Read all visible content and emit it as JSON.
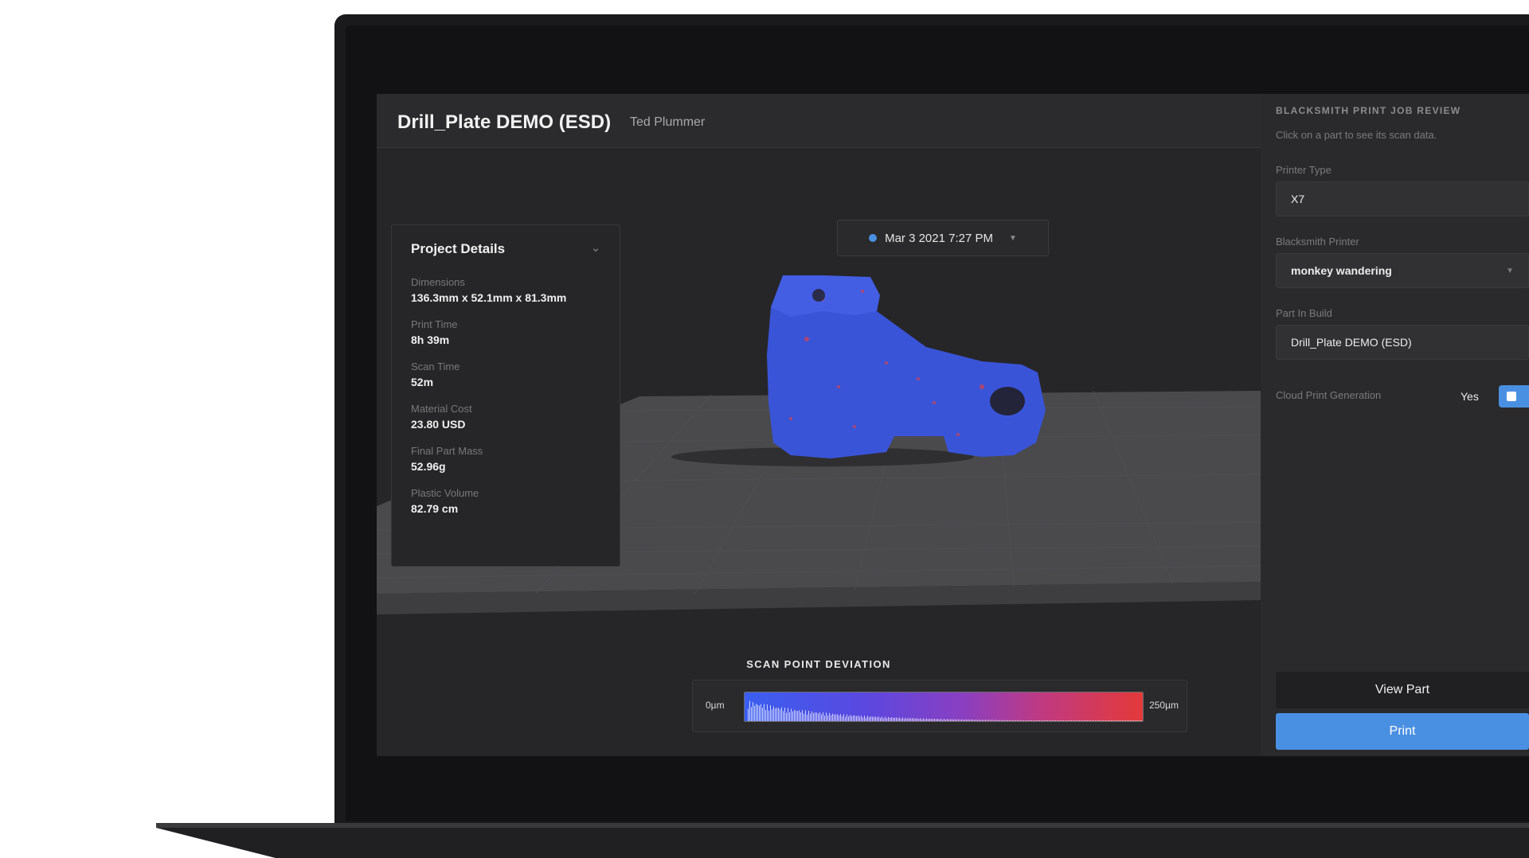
{
  "project": {
    "title": "Drill_Plate DEMO (ESD)",
    "owner": "Ted Plummer"
  },
  "timeline": {
    "date": "Mar 3 2021 7:27 PM"
  },
  "details": {
    "title": "Project Details",
    "items": [
      {
        "label": "Dimensions",
        "value": "136.3mm x 52.1mm x 81.3mm"
      },
      {
        "label": "Print Time",
        "value": "8h 39m"
      },
      {
        "label": "Scan Time",
        "value": "52m"
      },
      {
        "label": "Material Cost",
        "value": "23.80 USD"
      },
      {
        "label": "Final Part Mass",
        "value": "52.96g"
      },
      {
        "label": "Plastic Volume",
        "value": "82.79 cm"
      }
    ]
  },
  "legend": {
    "title": "SCAN POINT DEVIATION",
    "min": "0µm",
    "max": "250µm"
  },
  "sidebar": {
    "title": "BLACKSMITH PRINT JOB REVIEW",
    "subtitle": "Click on a part to see its scan data.",
    "printer_type_label": "Printer Type",
    "printer_type_value": "X7",
    "blacksmith_printer_label": "Blacksmith Printer",
    "blacksmith_printer_value": "monkey wandering",
    "part_in_build_label": "Part In Build",
    "part_in_build_value": "Drill_Plate DEMO (ESD)",
    "cloud_label": "Cloud Print Generation",
    "cloud_value": "Yes",
    "view_button": "View Part",
    "print_button": "Print"
  },
  "colors": {
    "accent": "#4a90e2",
    "deviation_low": "#3a5ff0",
    "deviation_high": "#e33a3a"
  }
}
